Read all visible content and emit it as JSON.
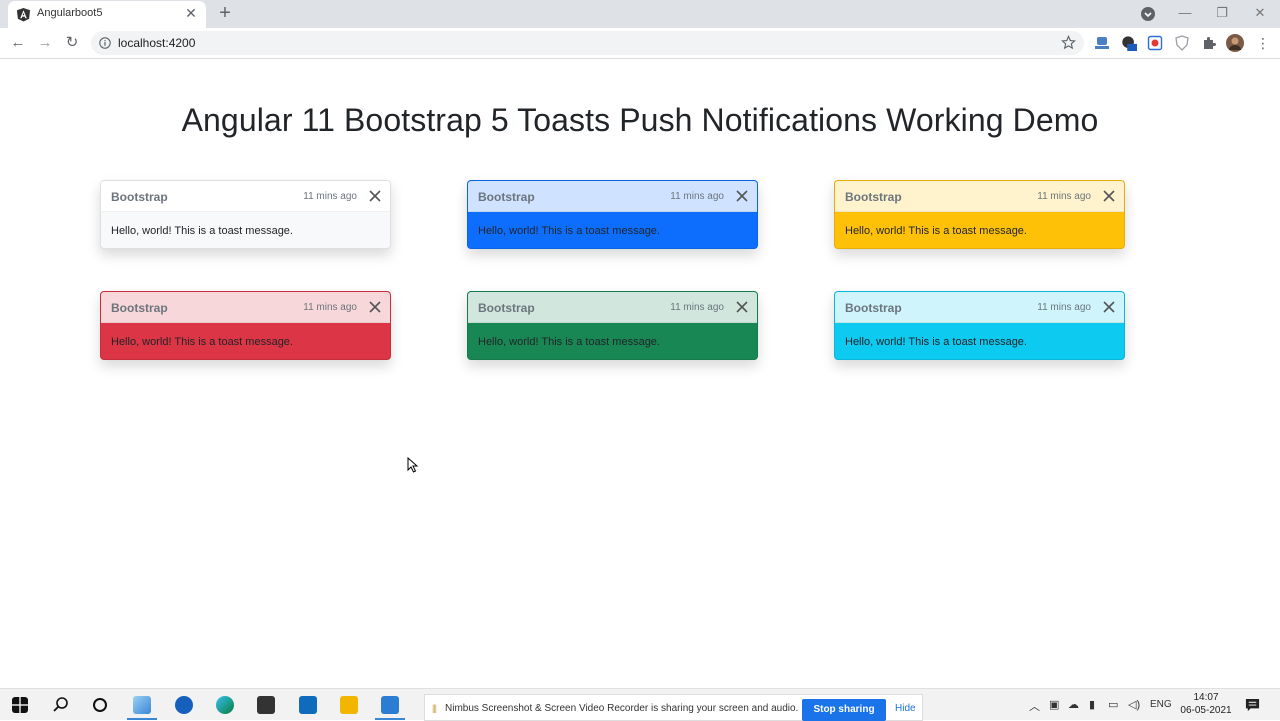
{
  "browser": {
    "tab_title": "Angularboot5",
    "url": "localhost:4200",
    "window_controls": {
      "minimize": "—",
      "maximize": "❐",
      "close": "✕"
    }
  },
  "page": {
    "title": "Angular 11 Bootstrap 5 Toasts Push Notifications Working Demo"
  },
  "toasts": [
    {
      "brand": "Bootstrap",
      "time": "11 mins ago",
      "body": "Hello, world! This is a toast message.",
      "header_bg": "#ffffff",
      "body_bg": "#f8f9fa"
    },
    {
      "brand": "Bootstrap",
      "time": "11 mins ago",
      "body": "Hello, world! This is a toast message.",
      "header_bg": "#cfe2ff",
      "body_bg": "#0d6efd"
    },
    {
      "brand": "Bootstrap",
      "time": "11 mins ago",
      "body": "Hello, world! This is a toast message.",
      "header_bg": "#fff3cd",
      "body_bg": "#ffc107"
    },
    {
      "brand": "Bootstrap",
      "time": "11 mins ago",
      "body": "Hello, world! This is a toast message.",
      "header_bg": "#f8d7da",
      "body_bg": "#dc3545"
    },
    {
      "brand": "Bootstrap",
      "time": "11 mins ago",
      "body": "Hello, world! This is a toast message.",
      "header_bg": "#d1e7dd",
      "body_bg": "#198754"
    },
    {
      "brand": "Bootstrap",
      "time": "11 mins ago",
      "body": "Hello, world! This is a toast message.",
      "header_bg": "#cff4fc",
      "body_bg": "#0dcaf0"
    }
  ],
  "taskbar": {
    "share_message": "Nimbus Screenshot & Screen Video Recorder is sharing your screen and audio.",
    "stop_label": "Stop sharing",
    "hide_label": "Hide",
    "language": "ENG",
    "time": "14:07",
    "date": "06-05-2021"
  }
}
